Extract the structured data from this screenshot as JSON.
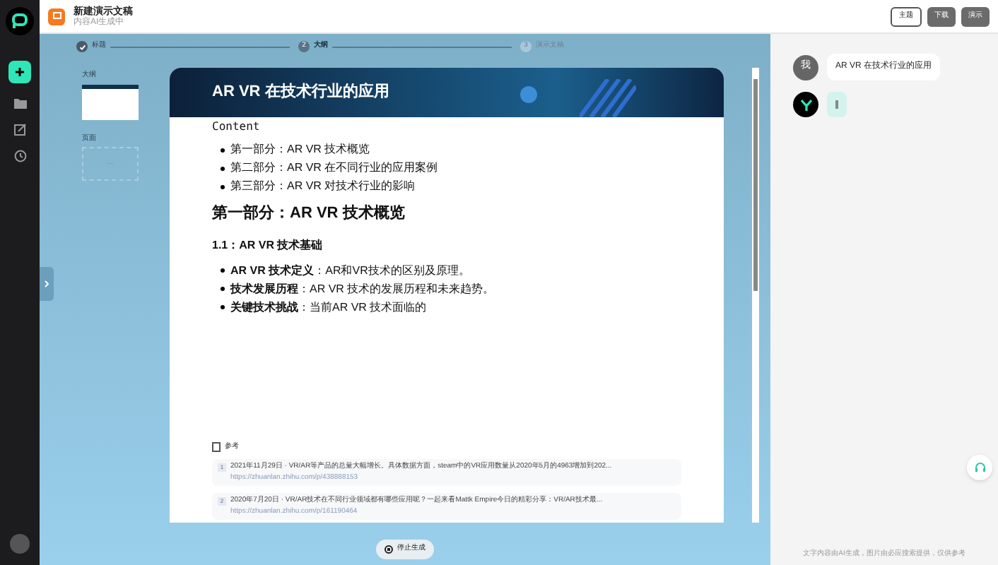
{
  "header": {
    "title": "新建演示文稿",
    "subtitle": "内容AI生成中",
    "buttons": [
      {
        "label": "主题",
        "kind": "outline"
      },
      {
        "label": "下载",
        "kind": "dark"
      },
      {
        "label": "演示",
        "kind": "dark"
      }
    ]
  },
  "steps": [
    {
      "label": "标题",
      "done": true,
      "selected": false
    },
    {
      "number": "2",
      "label": "大纲",
      "done": false,
      "selected": true
    },
    {
      "number": "3",
      "label": "演示文稿",
      "done": false,
      "selected": false
    }
  ],
  "thumbs": {
    "outline_label": "大纲",
    "pages_label": "页面",
    "pages_placeholder": "..."
  },
  "slide": {
    "title": "AR VR 在技术行业的应用",
    "content_label": "Content",
    "toc": [
      "第一部分：AR VR 技术概览",
      "第二部分：AR VR 在不同行业的应用案例",
      "第三部分：AR VR 对技术行业的影响"
    ],
    "heading": "第一部分：AR VR 技术概览",
    "subheading": "1.1：AR VR 技术基础",
    "points": [
      "**AR VR 技术定义**：AR和VR技术的区别及原理。",
      "**技术发展历程**：AR VR 技术的发展历程和未来趋势。",
      "**关键技术挑战**：当前AR VR 技术面临的"
    ]
  },
  "references": {
    "title": "参考",
    "items": [
      {
        "number": "1",
        "text": "2021年11月29日 · VR/AR等产品的总量大幅增长。具体数据方面，steam中的VR应用数量从2020年5月的4963增加到202...",
        "url": "https://zhuanlan.zhihu.com/p/438888153"
      },
      {
        "number": "2",
        "text": "2020年7月20日 · VR/AR技术在不同行业领域都有哪些应用呢？一起来看Mattk Empire今日的精彩分享：VR/AR技术最...",
        "url": "https://zhuanlan.zhihu.com/p/161190464"
      }
    ]
  },
  "stop_button": "停止生成",
  "chat": {
    "messages": [
      {
        "kind": "user",
        "avatar": "我",
        "text": "AR VR 在技术行业的应用"
      },
      {
        "kind": "bot",
        "typing": true
      }
    ],
    "footer": "文字内容由AI生成，图片由必应搜索提供，仅供参考"
  }
}
